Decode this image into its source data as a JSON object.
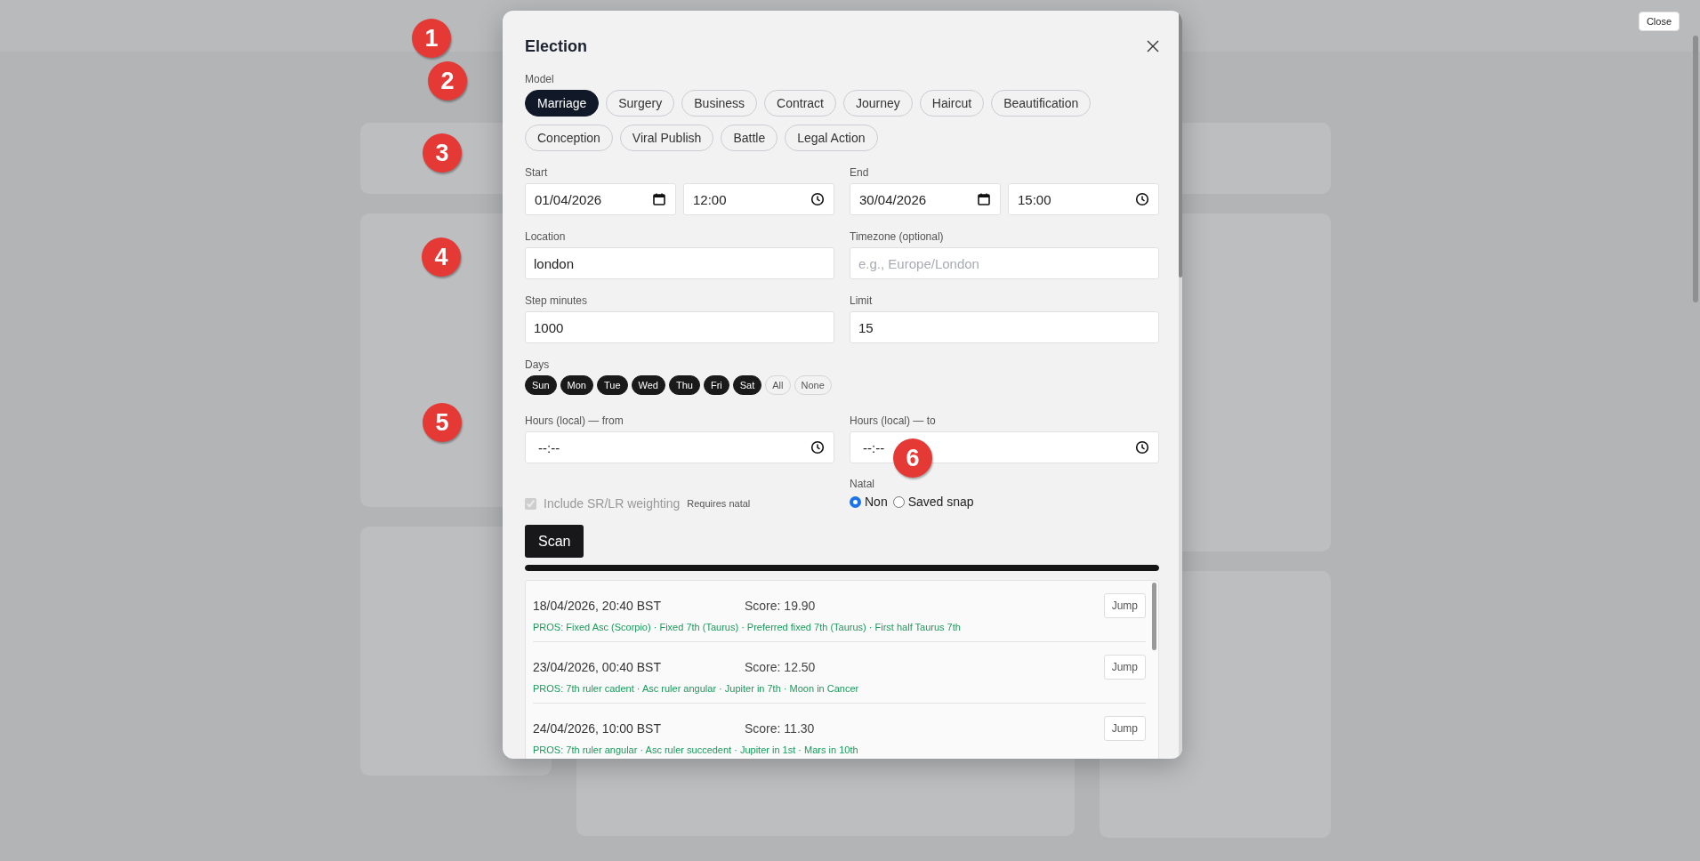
{
  "page": {
    "close_button": "Close"
  },
  "markers": [
    "1",
    "2",
    "3",
    "4",
    "5",
    "6"
  ],
  "dialog": {
    "title": "Election",
    "model_label": "Model",
    "models": [
      {
        "label": "Marriage",
        "selected": true
      },
      {
        "label": "Surgery",
        "selected": false
      },
      {
        "label": "Business",
        "selected": false
      },
      {
        "label": "Contract",
        "selected": false
      },
      {
        "label": "Journey",
        "selected": false
      },
      {
        "label": "Haircut",
        "selected": false
      },
      {
        "label": "Beautification",
        "selected": false
      },
      {
        "label": "Conception",
        "selected": false
      },
      {
        "label": "Viral Publish",
        "selected": false
      },
      {
        "label": "Battle",
        "selected": false
      },
      {
        "label": "Legal Action",
        "selected": false
      }
    ],
    "start": {
      "label": "Start",
      "date": "01/04/2026",
      "time": "12:00"
    },
    "end": {
      "label": "End",
      "date": "30/04/2026",
      "time": "15:00"
    },
    "location": {
      "label": "Location",
      "value": "london"
    },
    "timezone": {
      "label": "Timezone (optional)",
      "placeholder": "e.g., Europe/London"
    },
    "step": {
      "label": "Step minutes",
      "value": "1000"
    },
    "limit": {
      "label": "Limit",
      "value": "15"
    },
    "days_label": "Days",
    "days": [
      {
        "label": "Sun",
        "selected": true
      },
      {
        "label": "Mon",
        "selected": true
      },
      {
        "label": "Tue",
        "selected": true
      },
      {
        "label": "Wed",
        "selected": true
      },
      {
        "label": "Thu",
        "selected": true
      },
      {
        "label": "Fri",
        "selected": true
      },
      {
        "label": "Sat",
        "selected": true
      }
    ],
    "day_actions": [
      "All",
      "None"
    ],
    "hours_from": {
      "label": "Hours (local) — from",
      "placeholder": "--:--"
    },
    "hours_to": {
      "label": "Hours (local) — to",
      "placeholder": "--:--"
    },
    "weighting": {
      "label": "Include SR/LR weighting",
      "checked": true,
      "disabled": true,
      "note": "Requires natal"
    },
    "natal": {
      "label": "Natal",
      "options": [
        {
          "label": "Non",
          "selected": true
        },
        {
          "label": "Saved snap",
          "selected": false
        }
      ]
    },
    "scan_button": "Scan",
    "progress": {
      "level": 1
    },
    "results": [
      {
        "datetime": "18/04/2026, 20:40 BST",
        "score": "Score: 19.90",
        "pros": "PROS: Fixed Asc (Scorpio) · Fixed 7th (Taurus) · Preferred fixed 7th (Taurus) · First half Taurus 7th",
        "button": "Jump"
      },
      {
        "datetime": "23/04/2026, 00:40 BST",
        "score": "Score: 12.50",
        "pros": "PROS: 7th ruler cadent · Asc ruler angular · Jupiter in 7th · Moon in Cancer",
        "button": "Jump"
      },
      {
        "datetime": "24/04/2026, 10:00 BST",
        "score": "Score: 11.30",
        "pros": "PROS: 7th ruler angular · Asc ruler succedent · Jupiter in 1st · Mars in 10th",
        "button": "Jump"
      }
    ]
  }
}
